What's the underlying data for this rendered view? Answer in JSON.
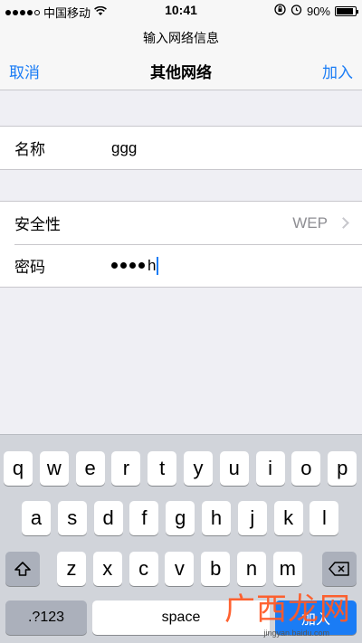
{
  "status_bar": {
    "carrier": "中国移动",
    "time": "10:41",
    "battery_percent": "90%",
    "battery_level": 0.9
  },
  "nav": {
    "prompt": "输入网络信息",
    "cancel_label": "取消",
    "title": "其他网络",
    "join_label": "加入"
  },
  "form": {
    "name_label": "名称",
    "name_value": "ggg",
    "security_label": "安全性",
    "security_value": "WEP",
    "password_label": "密码",
    "password_last_char": "h"
  },
  "keyboard": {
    "row1": [
      "q",
      "w",
      "e",
      "r",
      "t",
      "y",
      "u",
      "i",
      "o",
      "p"
    ],
    "row2": [
      "a",
      "s",
      "d",
      "f",
      "g",
      "h",
      "j",
      "k",
      "l"
    ],
    "row3": [
      "z",
      "x",
      "c",
      "v",
      "b",
      "n",
      "m"
    ],
    "numbers_label": ".?123",
    "space_label": "space",
    "go_label": "加入"
  },
  "watermark": {
    "text": "广西龙网",
    "sub": "jingyan.baidu.com"
  },
  "colors": {
    "accent": "#1a7cf5",
    "watermark": "#ff5a26"
  }
}
